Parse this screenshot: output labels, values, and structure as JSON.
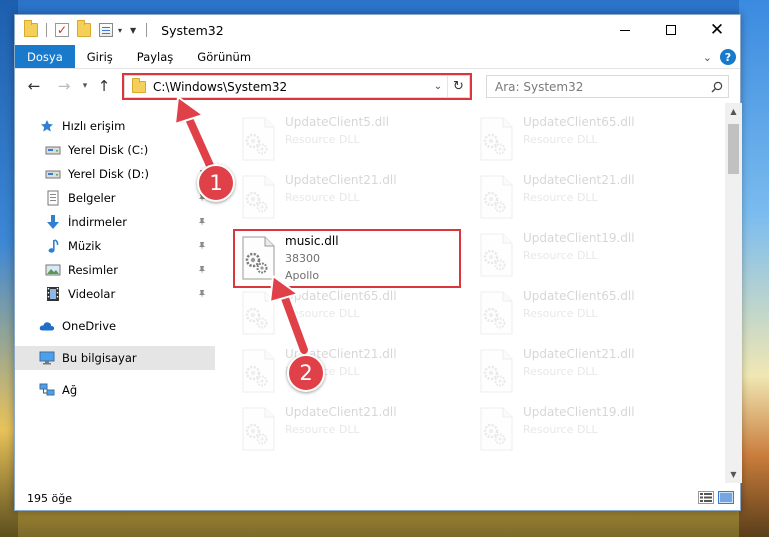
{
  "window": {
    "title": "System32",
    "controls": {
      "minimize": "minimize-icon",
      "maximize": "maximize-icon",
      "close": "close-icon"
    }
  },
  "ribbon": {
    "tabs": [
      "Dosya",
      "Giriş",
      "Paylaş",
      "Görünüm"
    ],
    "help": "?"
  },
  "navigation": {
    "address": "C:\\Windows\\System32",
    "search_placeholder": "Ara: System32"
  },
  "sidebar": {
    "items": [
      {
        "label": "Hızlı erişim",
        "icon": "star-icon",
        "pinned": false
      },
      {
        "label": "Yerel Disk (C:)",
        "icon": "drive-icon",
        "pinned": true
      },
      {
        "label": "Yerel Disk (D:)",
        "icon": "drive-icon",
        "pinned": true
      },
      {
        "label": "Belgeler",
        "icon": "documents-icon",
        "pinned": true
      },
      {
        "label": "İndirmeler",
        "icon": "download-icon",
        "pinned": true
      },
      {
        "label": "Müzik",
        "icon": "music-icon",
        "pinned": true
      },
      {
        "label": "Resimler",
        "icon": "pictures-icon",
        "pinned": true
      },
      {
        "label": "Videolar",
        "icon": "videos-icon",
        "pinned": true
      },
      {
        "label": "OneDrive",
        "icon": "cloud-icon",
        "pinned": false
      },
      {
        "label": "Bu bilgisayar",
        "icon": "computer-icon",
        "pinned": false,
        "selected": true
      },
      {
        "label": "Ağ",
        "icon": "network-icon",
        "pinned": false
      }
    ]
  },
  "files": {
    "highlighted": {
      "name": "music.dll",
      "line2": "38300",
      "line3": "Apollo"
    },
    "faded_left": [
      {
        "name": "UpdateClient5.dll",
        "type": "Resource DLL"
      },
      {
        "name": "UpdateClient21.dll",
        "type": "Resource DLL"
      },
      {
        "name": "UpdateClient65.dll",
        "type": "Resource DLL"
      },
      {
        "name": "UpdateClient21.dll",
        "type": "Resource DLL"
      },
      {
        "name": "UpdateClient21.dll",
        "type": "Resource DLL"
      }
    ],
    "faded_right": [
      {
        "name": "UpdateClient65.dll",
        "type": "Resource DLL"
      },
      {
        "name": "UpdateClient21.dll",
        "type": "Resource DLL"
      },
      {
        "name": "UpdateClient19.dll",
        "type": "Resource DLL"
      },
      {
        "name": "UpdateClient65.dll",
        "type": "Resource DLL"
      },
      {
        "name": "UpdateClient21.dll",
        "type": "Resource DLL"
      },
      {
        "name": "UpdateClient19.dll",
        "type": "Resource DLL"
      }
    ]
  },
  "status": {
    "count": "195 öğe"
  },
  "annotations": {
    "step1": "1",
    "step2": "2",
    "color": "#e04048"
  }
}
